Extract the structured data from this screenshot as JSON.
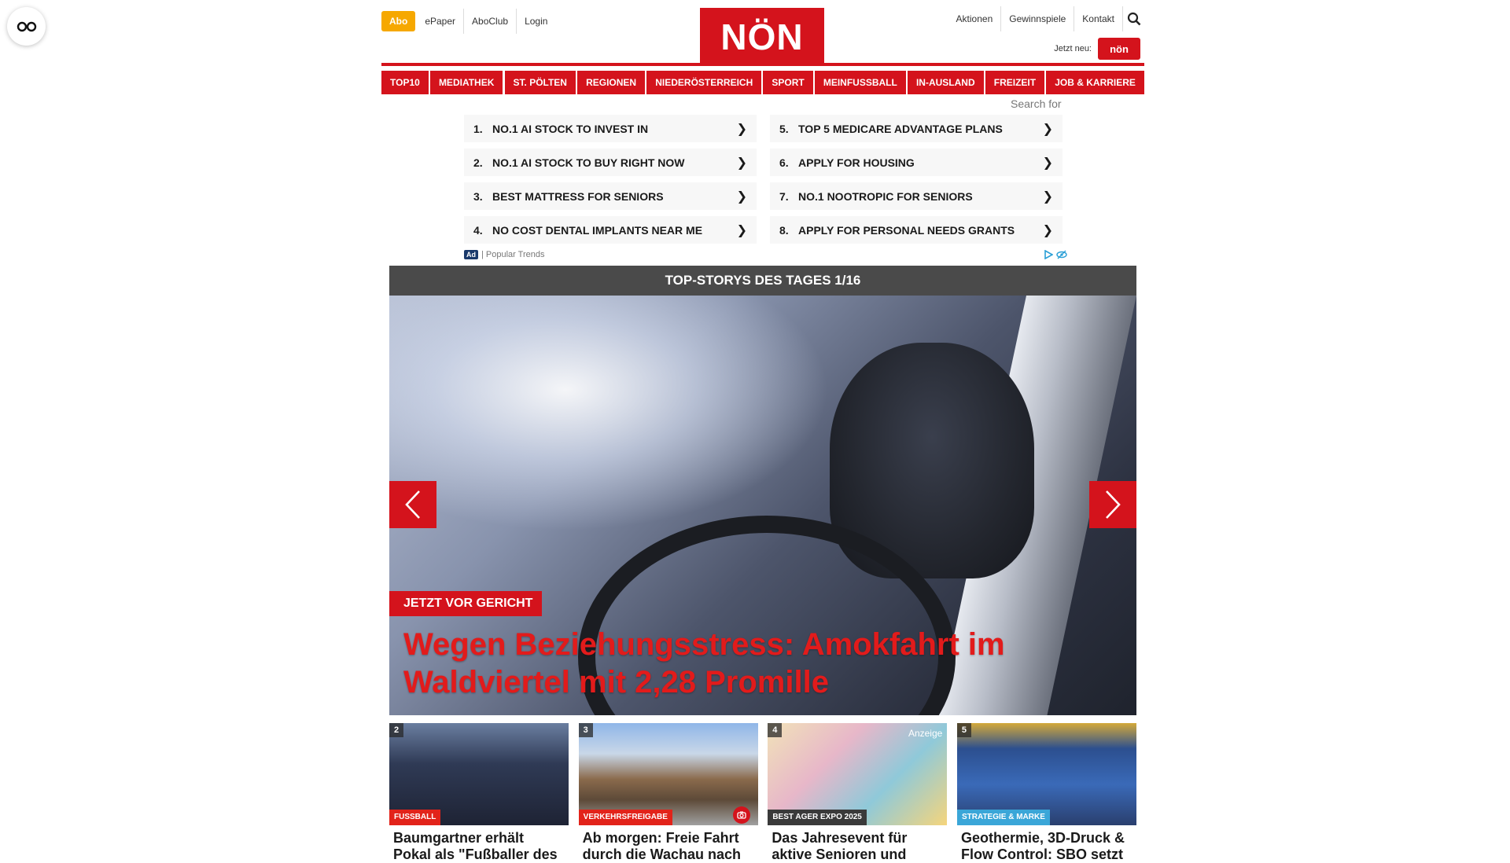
{
  "header": {
    "abo": "Abo",
    "left_links": [
      "ePaper",
      "AboClub",
      "Login"
    ],
    "logo": "NÖN",
    "right_links": [
      "Aktionen",
      "Gewinnspiele",
      "Kontakt"
    ],
    "jetzt_neu": "Jetzt neu:",
    "mini_logo": "nön"
  },
  "mainnav": [
    "TOP10",
    "MEDIATHEK",
    "ST. PÖLTEN",
    "REGIONEN",
    "NIEDERÖSTERREICH",
    "SPORT",
    "MEINFUSSBALL",
    "IN-AUSLAND",
    "FREIZEIT",
    "JOB & KARRIERE"
  ],
  "search_for": "Search for",
  "ad": {
    "items": [
      {
        "num": "1.",
        "text": "NO.1 AI STOCK TO INVEST IN"
      },
      {
        "num": "5.",
        "text": "TOP 5 MEDICARE ADVANTAGE PLANS"
      },
      {
        "num": "2.",
        "text": "NO.1 AI STOCK TO BUY RIGHT NOW"
      },
      {
        "num": "6.",
        "text": "APPLY FOR HOUSING"
      },
      {
        "num": "3.",
        "text": "BEST MATTRESS FOR SENIORS"
      },
      {
        "num": "7.",
        "text": "NO.1 NOOTROPIC FOR SENIORS"
      },
      {
        "num": "4.",
        "text": "NO COST DENTAL IMPLANTS NEAR ME"
      },
      {
        "num": "8.",
        "text": "APPLY FOR PERSONAL NEEDS GRANTS"
      }
    ],
    "badge": "Ad",
    "source": "| Popular Trends",
    "arrow": "❯"
  },
  "stories": {
    "header": "TOP-STORYS DES TAGES 1/16",
    "hero_tag": "JETZT VOR GERICHT",
    "hero_title": "Wegen Beziehungsstress: Amokfahrt im Waldviertel mit 2,28 Promille"
  },
  "cards": [
    {
      "num": "2",
      "category": "FUSSBALL",
      "cat_color": "#e2231a",
      "title": "Baumgartner erhält Pokal als \"Fußballer des"
    },
    {
      "num": "3",
      "category": "VERKEHRSFREIGABE",
      "cat_color": "#e2231a",
      "title": "Ab morgen: Freie Fahrt durch die Wachau nach"
    },
    {
      "num": "4",
      "category": "BEST AGER EXPO 2025",
      "cat_color": "#3a3a3a",
      "title": "Das Jahresevent für aktive Senioren und",
      "anzeige": "Anzeige"
    },
    {
      "num": "5",
      "category": "STRATEGIE & MARKE",
      "cat_color": "#3aa6d8",
      "title": "Geothermie, 3D-Druck & Flow Control: SBO setzt"
    }
  ],
  "colors": {
    "brand_red": "#d4131c",
    "abo_yellow": "#f6a800",
    "header_gray": "#4a4a4a"
  }
}
